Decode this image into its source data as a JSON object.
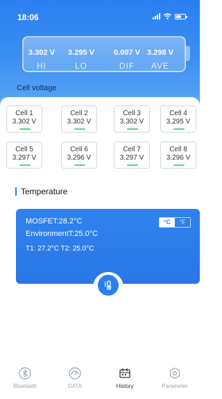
{
  "status_bar": {
    "time": "18:06"
  },
  "summary": {
    "stats": [
      {
        "value": "3.302 V",
        "label": "HI"
      },
      {
        "value": "3.295 V",
        "label": "LO"
      },
      {
        "value": "0.007 V",
        "label": "DIF"
      },
      {
        "value": "3.298 V",
        "label": "AVE"
      }
    ],
    "section_label": "Cell voltage"
  },
  "cells": [
    {
      "name": "Cell 1",
      "voltage": "3.302 V"
    },
    {
      "name": "Cell 2",
      "voltage": "3.302 V"
    },
    {
      "name": "Cell 3",
      "voltage": "3.302 V"
    },
    {
      "name": "Cell 4",
      "voltage": "3.295 V"
    },
    {
      "name": "Cell 5",
      "voltage": "3.297 V"
    },
    {
      "name": "Cell 6",
      "voltage": "3.296 V"
    },
    {
      "name": "Cell 7",
      "voltage": "3.297 V"
    },
    {
      "name": "Cell 8",
      "voltage": "3.296 V"
    }
  ],
  "temperature": {
    "title": "Temperature",
    "mosfet": "MOSFET:28.2°C",
    "environment": "EnvironmentT:25.0°C",
    "probes": "T1: 27.2°C   T2: 25.0°C",
    "unit_c": "°C",
    "unit_f": "°F",
    "selected_unit": "°C"
  },
  "tabs": [
    {
      "label": "Bluetooth",
      "icon": "bluetooth-icon",
      "active": false
    },
    {
      "label": "DATA",
      "icon": "gauge-icon",
      "active": false
    },
    {
      "label": "History",
      "icon": "history-icon",
      "active": true
    },
    {
      "label": "Parameter",
      "icon": "settings-icon",
      "active": false
    }
  ],
  "colors": {
    "accent": "#2b7ef0",
    "cell_ok": "#59d48a"
  }
}
